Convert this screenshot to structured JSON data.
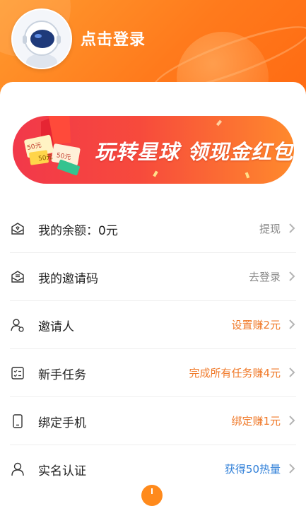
{
  "header": {
    "login_label": "点击登录",
    "colors": {
      "gradient_start": "#ff9a2e",
      "gradient_end": "#ff6a12"
    },
    "avatar_icon": "astronaut-avatar-icon"
  },
  "banner": {
    "text": "玩转星球 领现金红包",
    "badges": [
      "50元",
      "50元",
      "50元"
    ],
    "colors": {
      "start": "#f2384a",
      "end": "#ff8a2c"
    }
  },
  "menu": {
    "items": [
      {
        "icon": "wallet-icon",
        "label": "我的余额：0元",
        "value": "提现",
        "value_color": "#888888"
      },
      {
        "icon": "invite-code-icon",
        "label": "我的邀请码",
        "value": "去登录",
        "value_color": "#888888"
      },
      {
        "icon": "inviter-icon",
        "label": "邀请人",
        "value": "设置赚2元",
        "value_color": "#f07a2a"
      },
      {
        "icon": "task-list-icon",
        "label": "新手任务",
        "value": "完成所有任务赚4元",
        "value_color": "#f07a2a"
      },
      {
        "icon": "phone-icon",
        "label": "绑定手机",
        "value": "绑定赚1元",
        "value_color": "#f07a2a"
      },
      {
        "icon": "user-verify-icon",
        "label": "实名认证",
        "value": "获得50热量",
        "value_color": "#2f7fd8"
      }
    ]
  }
}
